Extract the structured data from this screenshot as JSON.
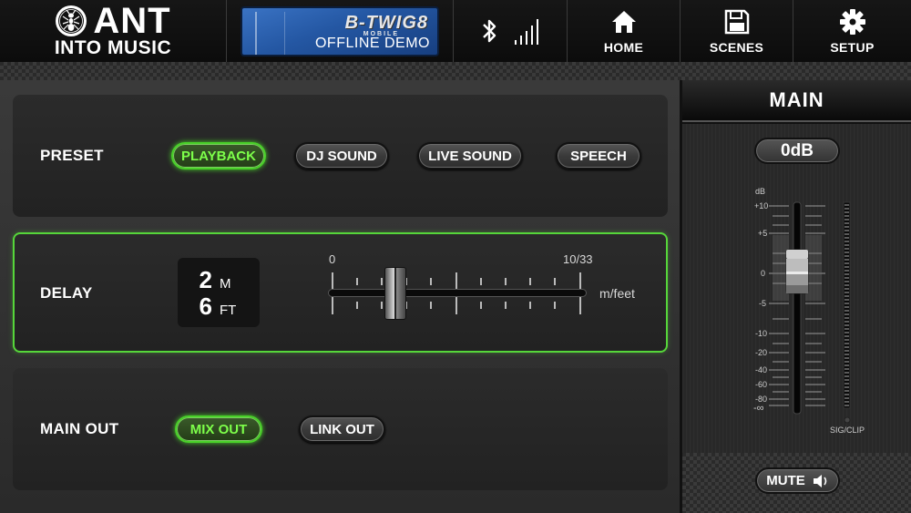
{
  "app": {
    "brand_name": "ANT",
    "brand_subtitle": "INTO MUSIC",
    "product_name": "B-TWIG8",
    "product_tag": "MOBILE",
    "product_mode": "OFFLINE DEMO"
  },
  "status": {
    "bluetooth_icon": "bluetooth-icon",
    "signal_icon": "signal-bars-icon"
  },
  "nav": {
    "home": {
      "label": "HOME",
      "icon": "home-icon"
    },
    "scenes": {
      "label": "SCENES",
      "icon": "floppy-disk-icon"
    },
    "setup": {
      "label": "SETUP",
      "icon": "gear-icon"
    }
  },
  "preset": {
    "label": "PRESET",
    "options": [
      "PLAYBACK",
      "DJ SOUND",
      "LIVE SOUND",
      "SPEECH"
    ],
    "selected": "PLAYBACK"
  },
  "delay": {
    "label": "DELAY",
    "meters": "2",
    "meters_unit": "M",
    "feet": "6",
    "feet_unit": "FT",
    "slider_min_label": "0",
    "slider_max_label": "10/33",
    "unit_label": "m/feet",
    "slider_value_fraction": 0.26
  },
  "main_out": {
    "label": "MAIN OUT",
    "options": [
      "MIX OUT",
      "LINK OUT"
    ],
    "selected": "MIX OUT"
  },
  "main_channel": {
    "title": "MAIN",
    "level_label": "0dB",
    "scale_title": "dB",
    "scale": [
      "+10",
      "+5",
      "0",
      "-5",
      "-10",
      "-20",
      "-40",
      "-60",
      "-80",
      "-∞"
    ],
    "sig_clip_label": "SIG/CLIP",
    "mute_label": "MUTE",
    "mute_icon": "speaker-icon",
    "accent_color": "#56d63a"
  }
}
